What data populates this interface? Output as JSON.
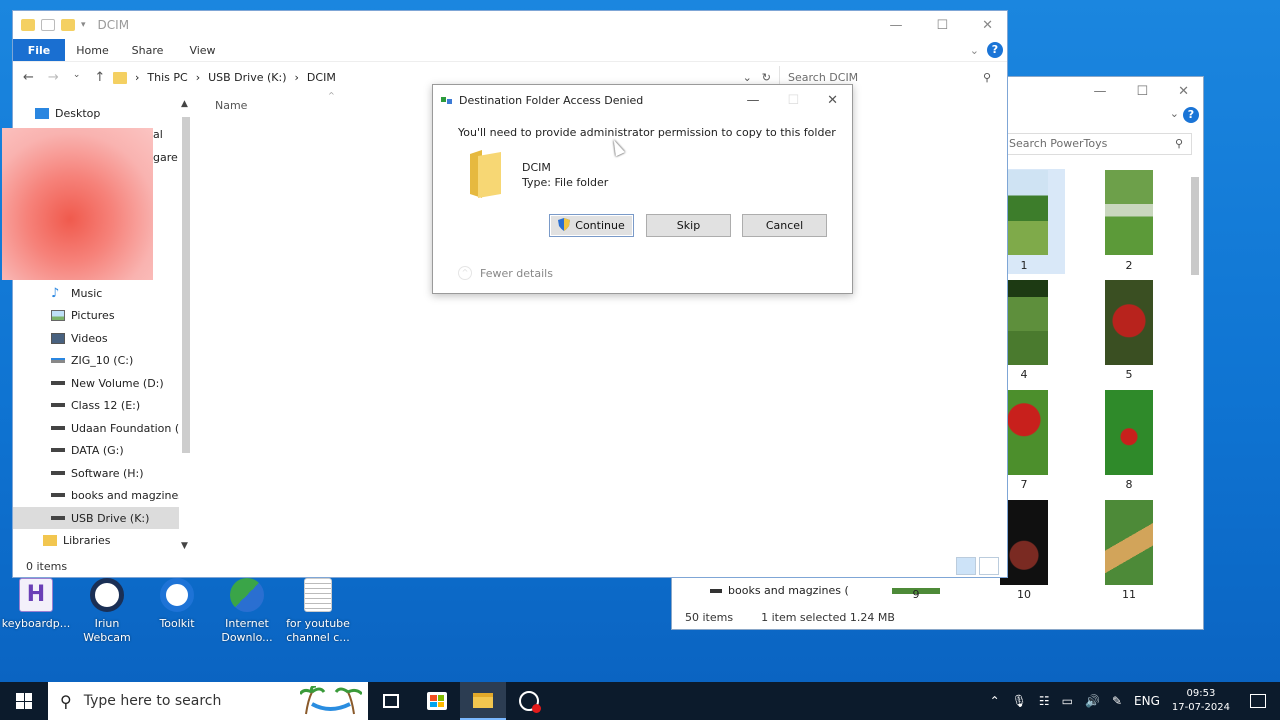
{
  "window": {
    "title": "DCIM",
    "ribbon_tabs": [
      "Home",
      "Share",
      "View"
    ],
    "file_tab": "File",
    "breadcrumb": [
      "This PC",
      "USB Drive (K:)",
      "DCIM"
    ],
    "search_placeholder": "Search DCIM",
    "column_name": "Name",
    "status": "0 items",
    "peek_text": [
      "al",
      "gare"
    ]
  },
  "nav": {
    "items": [
      {
        "label": "Desktop",
        "icon": "desktop-icon"
      },
      {
        "label": "Music",
        "icon": "music-icon"
      },
      {
        "label": "Pictures",
        "icon": "pictures-icon"
      },
      {
        "label": "Videos",
        "icon": "videos-icon"
      },
      {
        "label": "ZIG_10 (C:)",
        "icon": "drive-icon"
      },
      {
        "label": "New Volume (D:)",
        "icon": "drive-icon"
      },
      {
        "label": "Class 12 (E:)",
        "icon": "drive-icon"
      },
      {
        "label": "Udaan Foundation (F:)",
        "icon": "drive-icon"
      },
      {
        "label": "DATA (G:)",
        "icon": "drive-icon"
      },
      {
        "label": "Software  (H:)",
        "icon": "drive-icon"
      },
      {
        "label": "books and magzines (",
        "icon": "drive-icon"
      },
      {
        "label": "USB Drive (K:)",
        "icon": "drive-icon",
        "selected": true
      },
      {
        "label": "Libraries",
        "icon": "libraries-icon"
      }
    ]
  },
  "dialog": {
    "title": "Destination Folder Access Denied",
    "message": "You'll need to provide administrator permission to copy to this folder",
    "item_name": "DCIM",
    "item_type": "Type: File folder",
    "buttons": {
      "continue": "Continue",
      "skip": "Skip",
      "cancel": "Cancel"
    },
    "details_toggle": "Fewer details"
  },
  "back_window": {
    "search_placeholder": "Search PowerToys",
    "thumbnails": [
      "1",
      "2",
      "4",
      "5",
      "7",
      "8",
      "9",
      "10",
      "11"
    ],
    "nav_item": "books and magzines (",
    "status_items": "50 items",
    "status_selected": "1 item selected  1.24 MB"
  },
  "desktop_icons": [
    {
      "label": "keyboardp...",
      "icon": "hotkey-app-icon"
    },
    {
      "label": "Iriun Webcam",
      "icon": "webcam-icon"
    },
    {
      "label": "Toolkit",
      "icon": "toolkit-icon"
    },
    {
      "label": "Internet Downlo...",
      "icon": "idm-icon"
    },
    {
      "label": "for youtube channel c...",
      "icon": "text-file-icon"
    }
  ],
  "taskbar": {
    "search_placeholder": "Type here to search",
    "language": "ENG",
    "time": "09:53",
    "date": "17-07-2024"
  }
}
